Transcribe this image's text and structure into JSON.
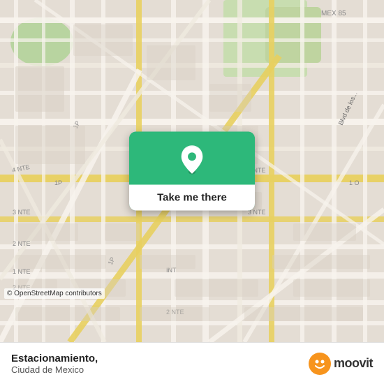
{
  "map": {
    "background_color": "#ddd9ce",
    "attribution": "© OpenStreetMap contributors"
  },
  "button": {
    "label": "Take me there",
    "bg_color": "#2db87a"
  },
  "bottom_bar": {
    "location_name": "Estacionamiento,",
    "location_city": "Ciudad de Mexico"
  },
  "moovit": {
    "text": "moovit",
    "icon_color": "#f7941d"
  }
}
